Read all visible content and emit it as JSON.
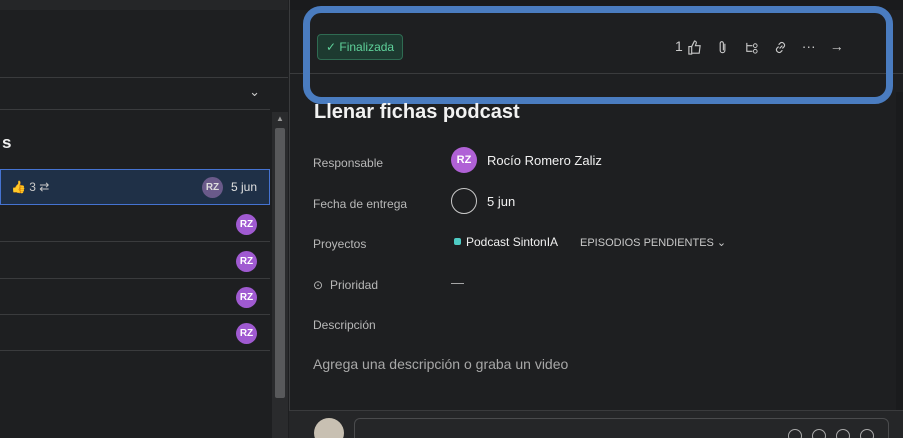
{
  "left_panel": {
    "section_title": "s",
    "selected_row": {
      "meta": "👍 3 ⇄",
      "avatar": "RZ",
      "due": "5 jun"
    },
    "rows": [
      {
        "avatar": "RZ"
      },
      {
        "avatar": "RZ"
      },
      {
        "avatar": "RZ"
      },
      {
        "avatar": "RZ"
      }
    ]
  },
  "toolbar": {
    "status_label": "✓ Finalizada",
    "like_count": "1"
  },
  "task": {
    "title": "Llenar fichas podcast",
    "fields": {
      "assignee_label": "Responsable",
      "assignee_initials": "RZ",
      "assignee_name": "Rocío Romero Zaliz",
      "due_label": "Fecha de entrega",
      "due_value": "5 jun",
      "projects_label": "Proyectos",
      "project_name": "Podcast SintonIA",
      "project_section": "EPISODIOS PENDIENTES ⌄",
      "priority_label": "Prioridad",
      "priority_value": "—",
      "description_label": "Descripción",
      "description_placeholder": "Agrega una descripción o graba un video"
    }
  },
  "colors": {
    "accent_blue": "#4a7cc0",
    "status_green": "#5fd19a",
    "avatar_purple": "#b061d6",
    "project_teal": "#4ecbc4"
  }
}
